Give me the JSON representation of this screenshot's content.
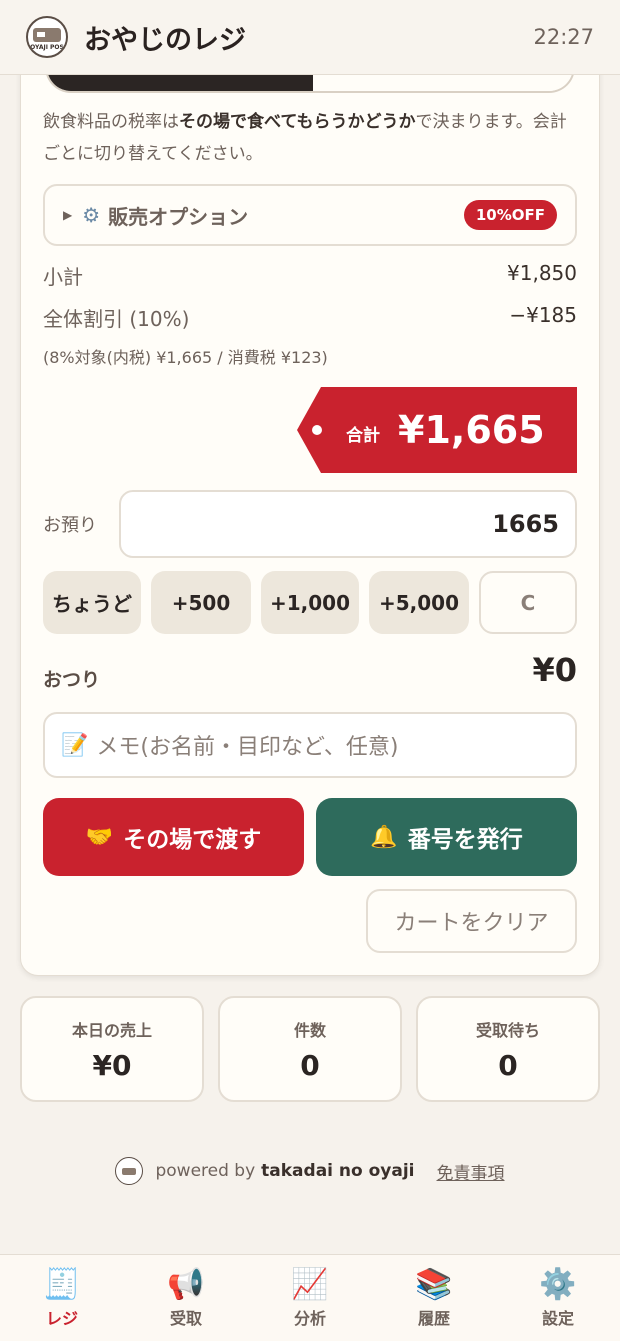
{
  "header": {
    "title": "おやじのレジ",
    "time": "22:27",
    "logo_text": "OYAJI POS"
  },
  "tax_note": {
    "prefix": "飲食料品の税率は",
    "bold": "その場で食べてもらうかどうか",
    "suffix": "で決まります。会計ごとに切り替えてください。"
  },
  "options": {
    "label": "販売オプション",
    "badge": "10%OFF"
  },
  "summary": {
    "subtotal_label": "小計",
    "subtotal_value": "¥1,850",
    "discount_label": "全体割引 (10%)",
    "discount_value": "−¥185",
    "tax_line": "(8%対象(内税) ¥1,665 / 消費税 ¥123)"
  },
  "total": {
    "label": "合計",
    "value": "¥1,665"
  },
  "deposit": {
    "label": "お預り",
    "value": "1665"
  },
  "quick_buttons": [
    "ちょうど",
    "+500",
    "+1,000",
    "+5,000",
    "C"
  ],
  "change": {
    "label": "おつり",
    "value": "¥0"
  },
  "memo": {
    "placeholder": "メモ(お名前・目印など、任意)"
  },
  "actions": {
    "hand_over": "その場で渡す",
    "issue_number": "番号を発行",
    "clear_cart": "カートをクリア"
  },
  "stats": [
    {
      "label": "本日の売上",
      "value": "¥0"
    },
    {
      "label": "件数",
      "value": "0"
    },
    {
      "label": "受取待ち",
      "value": "0"
    }
  ],
  "footer": {
    "powered": "powered by",
    "brand": "takadai no oyaji",
    "disclaimer": "免責事項"
  },
  "tabs": [
    {
      "label": "レジ",
      "icon": "receipt-icon"
    },
    {
      "label": "受取",
      "icon": "megaphone-icon"
    },
    {
      "label": "分析",
      "icon": "chart-icon"
    },
    {
      "label": "履歴",
      "icon": "books-icon"
    },
    {
      "label": "設定",
      "icon": "gear-icon"
    }
  ],
  "colors": {
    "accent_red": "#c9222e",
    "accent_green": "#2e6b5c",
    "background": "#f6f2ec"
  }
}
